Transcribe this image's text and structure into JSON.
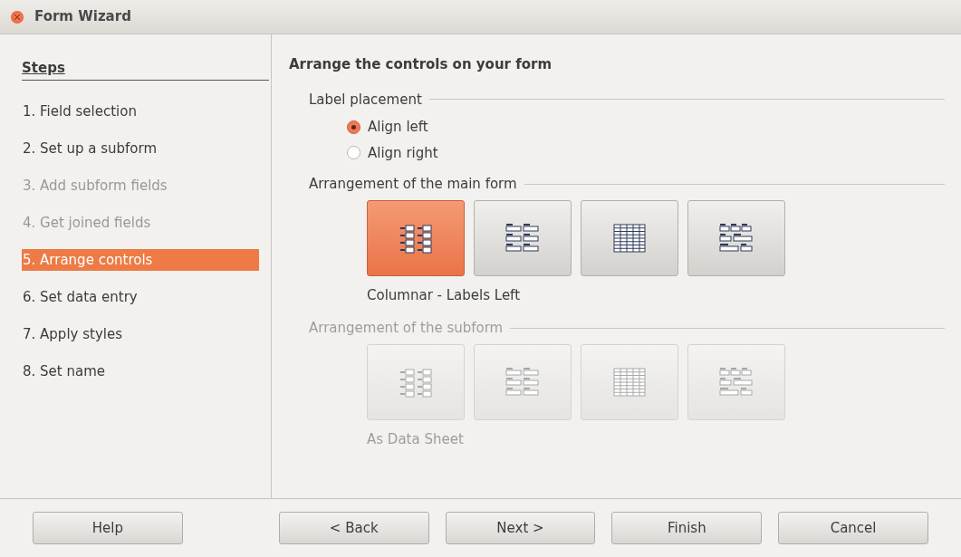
{
  "window": {
    "title": "Form Wizard"
  },
  "sidebar": {
    "heading": "Steps",
    "items": [
      {
        "label": "1. Field selection",
        "selected": false,
        "disabled": false
      },
      {
        "label": "2. Set up a subform",
        "selected": false,
        "disabled": false
      },
      {
        "label": "3. Add subform fields",
        "selected": false,
        "disabled": true
      },
      {
        "label": "4. Get joined fields",
        "selected": false,
        "disabled": true
      },
      {
        "label": "5. Arrange controls",
        "selected": true,
        "disabled": false
      },
      {
        "label": "6. Set data entry",
        "selected": false,
        "disabled": false
      },
      {
        "label": "7. Apply styles",
        "selected": false,
        "disabled": false
      },
      {
        "label": "8. Set name",
        "selected": false,
        "disabled": false
      }
    ]
  },
  "page": {
    "title": "Arrange the controls on your form",
    "label_placement": {
      "legend": "Label placement",
      "options": [
        {
          "label": "Align left",
          "selected": true
        },
        {
          "label": "Align right",
          "selected": false
        }
      ]
    },
    "main_form": {
      "legend": "Arrangement of the main form",
      "disabled": false,
      "caption": "Columnar - Labels Left",
      "layouts": [
        {
          "kind": "columnar-left",
          "selected": true
        },
        {
          "kind": "columnar-top",
          "selected": false
        },
        {
          "kind": "datasheet",
          "selected": false
        },
        {
          "kind": "block",
          "selected": false
        }
      ]
    },
    "subform": {
      "legend": "Arrangement of the subform",
      "disabled": true,
      "caption": "As Data Sheet",
      "layouts": [
        {
          "kind": "columnar-left",
          "selected": false
        },
        {
          "kind": "columnar-top",
          "selected": false
        },
        {
          "kind": "datasheet",
          "selected": false
        },
        {
          "kind": "block",
          "selected": false
        }
      ]
    }
  },
  "buttons": [
    "Help",
    "< Back",
    "Next >",
    "Finish",
    "Cancel"
  ]
}
